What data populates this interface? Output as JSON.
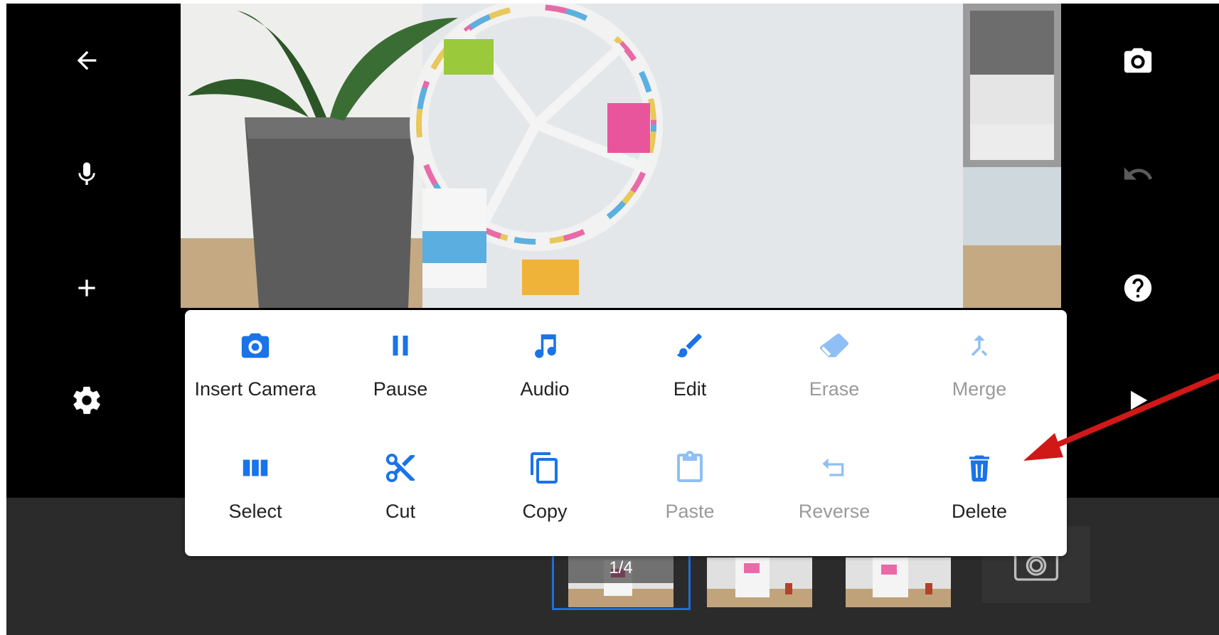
{
  "left_toolbar": {
    "icons": [
      "back-arrow-icon",
      "microphone-icon",
      "plus-icon",
      "gear-icon"
    ]
  },
  "right_toolbar": {
    "icons": [
      "camera-icon",
      "undo-icon",
      "help-icon",
      "play-icon"
    ]
  },
  "menu": {
    "row1": [
      {
        "label": "Insert Camera",
        "icon": "camera-icon",
        "enabled": true
      },
      {
        "label": "Pause",
        "icon": "pause-icon",
        "enabled": true
      },
      {
        "label": "Audio",
        "icon": "music-note-icon",
        "enabled": true
      },
      {
        "label": "Edit",
        "icon": "brush-icon",
        "enabled": true
      },
      {
        "label": "Erase",
        "icon": "eraser-icon",
        "enabled": false
      },
      {
        "label": "Merge",
        "icon": "merge-icon",
        "enabled": false
      }
    ],
    "row2": [
      {
        "label": "Select",
        "icon": "select-frames-icon",
        "enabled": true
      },
      {
        "label": "Cut",
        "icon": "scissors-icon",
        "enabled": true
      },
      {
        "label": "Copy",
        "icon": "copy-icon",
        "enabled": true
      },
      {
        "label": "Paste",
        "icon": "clipboard-icon",
        "enabled": false
      },
      {
        "label": "Reverse",
        "icon": "reverse-icon",
        "enabled": false
      },
      {
        "label": "Delete",
        "icon": "trash-icon",
        "enabled": true
      }
    ]
  },
  "timeline": {
    "frame_counter": "1/4",
    "colors": {
      "selection": "#1e6fd9",
      "menu_icon": "#1a73e8",
      "menu_icon_disabled": "#8fbff5",
      "annotation": "#d01818"
    }
  }
}
